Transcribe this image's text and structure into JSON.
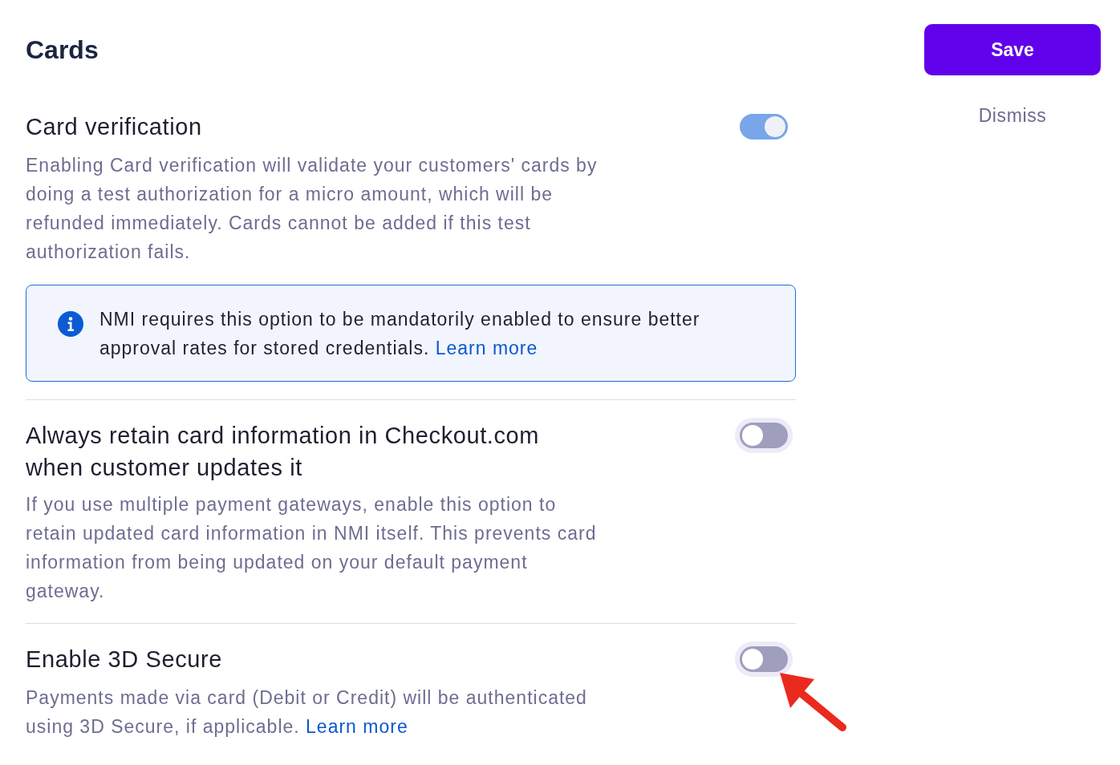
{
  "page": {
    "title": "Cards"
  },
  "actions": {
    "save": "Save",
    "dismiss": "Dismiss"
  },
  "settings": [
    {
      "title": "Card verification",
      "description": "Enabling Card verification will validate your customers' cards by doing a test authorization for a micro amount, which will be refunded immediately. Cards cannot be added if this test authorization fails.",
      "toggle": {
        "on": true,
        "disabled": true
      },
      "annotated": false,
      "notice": {
        "text": "NMI requires this option to be mandatorily enabled to ensure better approval rates for stored credentials.",
        "link": "Learn more"
      }
    },
    {
      "title": "Always retain card information in Checkout.com when customer updates it",
      "description": "If you use multiple payment gateways, enable this option to retain updated card information in NMI itself. This prevents card information from being updated on your default payment gateway.",
      "toggle": {
        "on": false,
        "disabled": false
      },
      "annotated": false
    },
    {
      "title": "Enable 3D Secure",
      "description": "Payments made via card (Debit or Credit) will be authenticated using 3D Secure, if applicable.",
      "link": "Learn more",
      "toggle": {
        "on": false,
        "disabled": false
      },
      "annotated": true
    }
  ]
}
